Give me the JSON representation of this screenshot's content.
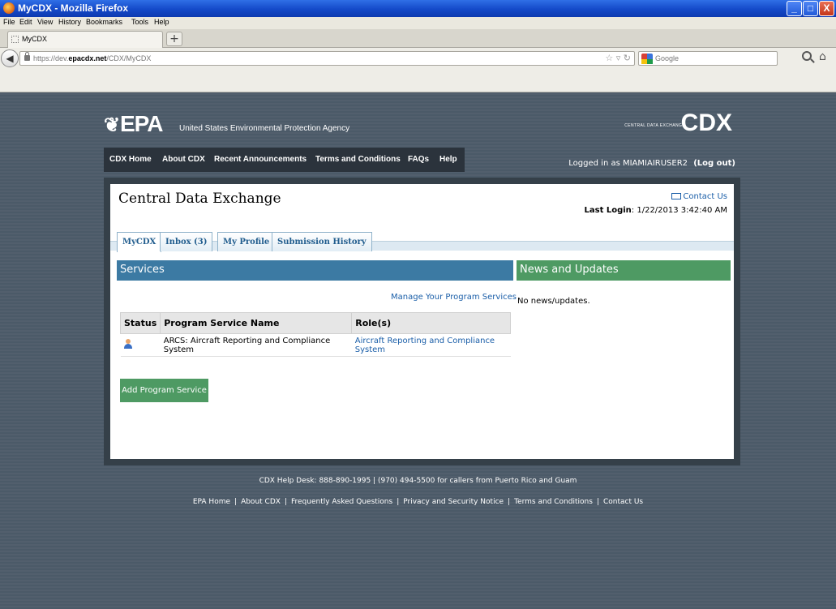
{
  "window": {
    "title": "MyCDX - Mozilla Firefox",
    "buttons": {
      "minimize": "_",
      "maximize": "□",
      "close": "X"
    }
  },
  "menubar": [
    "File",
    "Edit",
    "View",
    "History",
    "Bookmarks",
    "Tools",
    "Help"
  ],
  "browser": {
    "tab_title": "MyCDX",
    "new_tab": "+",
    "back": "◀",
    "url_prefix": "https://dev.",
    "url_domain": "epacdx.net",
    "url_path": "/CDX/MyCDX",
    "search_engine": "Google"
  },
  "header": {
    "epa_logo": "EPA",
    "agency": "United States Environmental Protection Agency",
    "cdx_logo": "CDX",
    "cdx_subtitle": "CENTRAL DATA EXCHANGE"
  },
  "topnav": [
    "CDX Home",
    "About CDX",
    "Recent Announcements",
    "Terms and Conditions",
    "FAQs",
    "Help"
  ],
  "user": {
    "logged_in_label": "Logged in as MIAMIAIRUSER2",
    "logout": "(Log out)"
  },
  "main": {
    "title": "Central Data Exchange",
    "contact": "Contact Us",
    "last_login_label": "Last Login",
    "last_login_value": ": 1/22/2013 3:42:40 AM",
    "tabs": [
      {
        "label": "MyCDX",
        "active": true
      },
      {
        "label": "Inbox (3)",
        "active": false
      },
      {
        "label": "My Profile",
        "active": false
      },
      {
        "label": "Submission History",
        "active": false
      }
    ],
    "services": {
      "heading": "Services",
      "manage_link": "Manage Your Program Services",
      "columns": [
        "Status",
        "Program Service Name",
        "Role(s)"
      ],
      "rows": [
        {
          "status_icon": "person-icon",
          "name": "ARCS: Aircraft Reporting and Compliance System",
          "role": "Aircraft Reporting and Compliance System"
        }
      ],
      "add_button": "Add Program Service"
    },
    "news": {
      "heading": "News and Updates",
      "empty": "No news/updates."
    }
  },
  "footer": {
    "helpdesk": "CDX Help Desk: 888-890-1995 | (970) 494-5500 for callers from Puerto Rico and Guam",
    "links": [
      "EPA Home",
      "About CDX",
      "Frequently Asked Questions",
      "Privacy and Security Notice",
      "Terms and Conditions",
      "Contact Us"
    ]
  },
  "colors": {
    "page_bg": "#4b5a68",
    "services_blue": "#3c7aa3",
    "news_green": "#4e9a63",
    "link_blue": "#1a5ea8"
  }
}
